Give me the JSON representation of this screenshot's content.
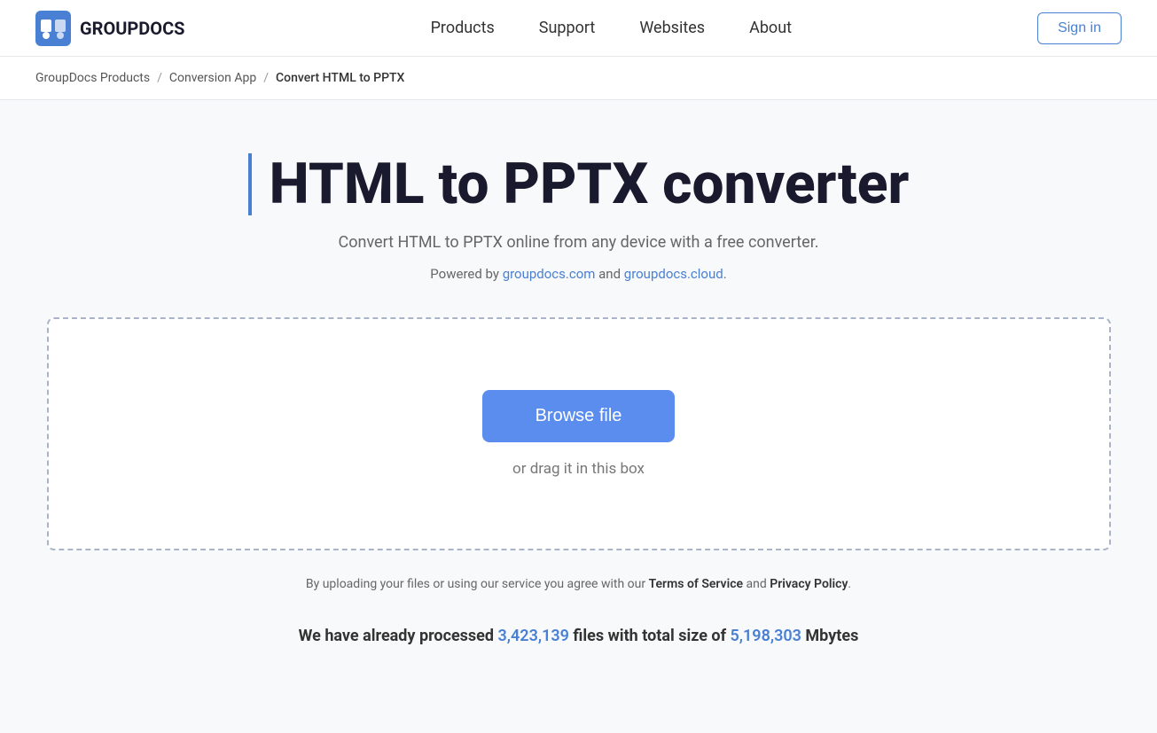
{
  "header": {
    "logo_text": "GROUPDOCS",
    "nav": {
      "products": "Products",
      "support": "Support",
      "websites": "Websites",
      "about": "About"
    },
    "sign_in": "Sign in"
  },
  "breadcrumb": {
    "root": "GroupDocs Products",
    "app": "Conversion App",
    "current": "Convert HTML to PPTX"
  },
  "main": {
    "title": "HTML to PPTX converter",
    "subtitle": "Convert HTML to PPTX online from any device with a free converter.",
    "powered_by_prefix": "Powered by ",
    "powered_by_link1": "groupdocs.com",
    "powered_by_link1_href": "https://groupdocs.com",
    "powered_by_and": " and ",
    "powered_by_link2": "groupdocs.cloud",
    "powered_by_link2_href": "https://groupdocs.cloud",
    "powered_by_suffix": ".",
    "browse_btn": "Browse file",
    "drag_text": "or drag it in this box",
    "terms_prefix": "By uploading your files or using our service you agree with our ",
    "terms_link1": "Terms of Service",
    "terms_and": " and ",
    "terms_link2": "Privacy Policy",
    "terms_suffix": ".",
    "stats_prefix": "We have already processed ",
    "stats_files": "3,423,139",
    "stats_middle": " files with total size of ",
    "stats_size": "5,198,303",
    "stats_suffix": " Mbytes"
  }
}
